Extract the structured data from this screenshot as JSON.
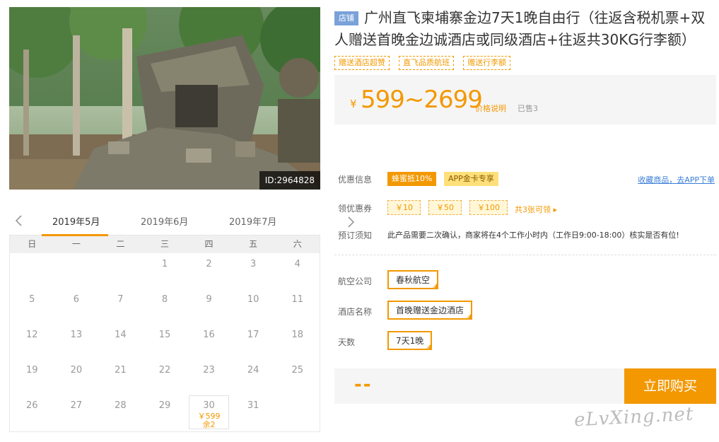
{
  "photo": {
    "id_label": "ID:2964828"
  },
  "calendar": {
    "months": [
      "2019年5月",
      "2019年6月",
      "2019年7月"
    ],
    "weekdays": [
      "日",
      "一",
      "二",
      "三",
      "四",
      "五",
      "六"
    ],
    "days": {
      "r0": [
        "",
        "",
        "",
        "1",
        "2",
        "3",
        "4"
      ],
      "r1": [
        "5",
        "6",
        "7",
        "8",
        "9",
        "10",
        "11"
      ],
      "r2": [
        "12",
        "13",
        "14",
        "15",
        "16",
        "17",
        "18"
      ],
      "r3": [
        "19",
        "20",
        "21",
        "22",
        "23",
        "24",
        "25"
      ],
      "r4": [
        "26",
        "27",
        "28",
        "29",
        "30",
        "31",
        ""
      ]
    },
    "available": {
      "day": "30",
      "price": "￥599",
      "remain": "余2"
    }
  },
  "product": {
    "shop_tag": "店铺",
    "title": "广州直飞柬埔寨金边7天1晚自由行（往返含税机票+双人赠送首晚金边诚酒店或同级酒店+往返共30KG行李额）",
    "tags": [
      "赠送酒店超赞",
      "直飞品质航班",
      "赠送行李额"
    ]
  },
  "price": {
    "symbol": "¥",
    "range": "599~2699",
    "explain": "价格说明",
    "sold": "已售3"
  },
  "promo": {
    "label": "优惠信息",
    "badges": [
      "蜂蜜抵10%",
      "APP金卡专享"
    ],
    "fav_link": "收藏商品，去APP下单"
  },
  "coupons": {
    "label": "领优惠券",
    "items": [
      "￥10",
      "￥50",
      "￥100"
    ],
    "all": "共3张可领 ▸"
  },
  "notice": {
    "label": "预订须知",
    "text": "此产品需要二次确认，商家将在4个工作小时内（工作日9:00-18:00）核实是否有位!"
  },
  "options": {
    "airline_label": "航空公司",
    "airline": "春秋航空",
    "hotel_label": "酒店名称",
    "hotel": "首晚赠送金边酒店",
    "days_label": "天数",
    "days": "7天1晚"
  },
  "buy": {
    "placeholder": "--",
    "button": "立即购买"
  },
  "watermark": "eLvXing.net",
  "colors": {
    "accent": "#f39800",
    "link": "#3a7ed8",
    "shop_tag": "#7aa1d9"
  }
}
